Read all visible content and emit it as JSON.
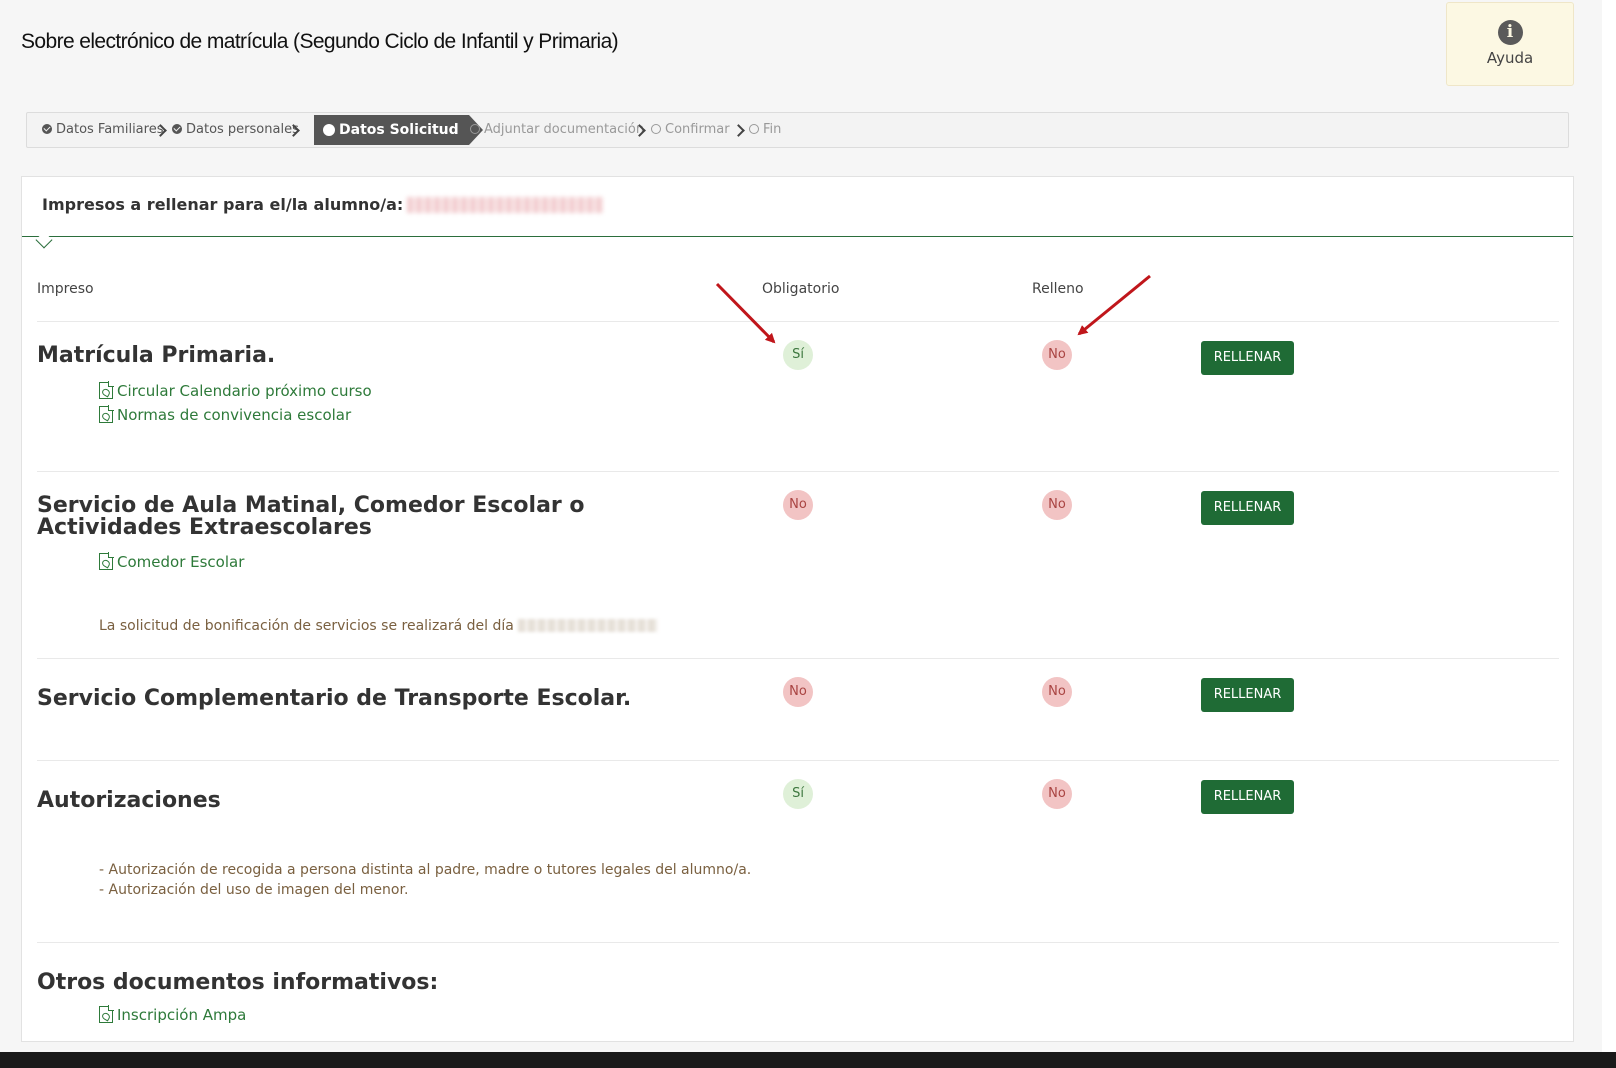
{
  "header": {
    "title": "Sobre electrónico de matrícula (Segundo Ciclo de Infantil y Primaria)",
    "help_label": "Ayuda",
    "help_icon": "info-circle-icon"
  },
  "wizard": {
    "steps": [
      {
        "label": "Datos Familiares",
        "state": "done"
      },
      {
        "label": "Datos personales",
        "state": "done"
      },
      {
        "label": "Datos Solicitud",
        "state": "active"
      },
      {
        "label": "Adjuntar documentación",
        "state": "pending"
      },
      {
        "label": "Confirmar",
        "state": "pending"
      },
      {
        "label": "Fin",
        "state": "pending"
      }
    ]
  },
  "panel": {
    "heading": "Impresos a rellenar para el/la alumno/a:",
    "columns": {
      "impreso": "Impreso",
      "obligatorio": "Obligatorio",
      "relleno": "Relleno"
    }
  },
  "forms": [
    {
      "title": "Matrícula Primaria.",
      "obligatorio": "Sí",
      "relleno": "No",
      "button": "RELLENAR",
      "links": [
        "Circular Calendario próximo curso",
        "Normas de convivencia escolar"
      ]
    },
    {
      "title_line1": "Servicio de Aula Matinal, Comedor Escolar o",
      "title_line2": "Actividades Extraescolares",
      "obligatorio": "No",
      "relleno": "No",
      "button": "RELLENAR",
      "links": [
        "Comedor Escolar"
      ],
      "note": "La solicitud de bonificación de servicios se realizará del día"
    },
    {
      "title": "Servicio Complementario de Transporte Escolar.",
      "obligatorio": "No",
      "relleno": "No",
      "button": "RELLENAR"
    },
    {
      "title": "Autorizaciones",
      "obligatorio": "Sí",
      "relleno": "No",
      "button": "RELLENAR",
      "notes": [
        "- Autorización de recogida a persona distinta al padre, madre o tutores legales del alumno/a.",
        "- Autorización del uso de imagen del menor."
      ]
    }
  ],
  "other_docs": {
    "title": "Otros documentos informativos:",
    "links": [
      "Inscripción Ampa"
    ]
  },
  "colors": {
    "accent": "#1f6b35",
    "yes_bg": "#dff0d8",
    "no_bg": "#f2c4c4",
    "annotation_arrow": "#c0161b"
  }
}
